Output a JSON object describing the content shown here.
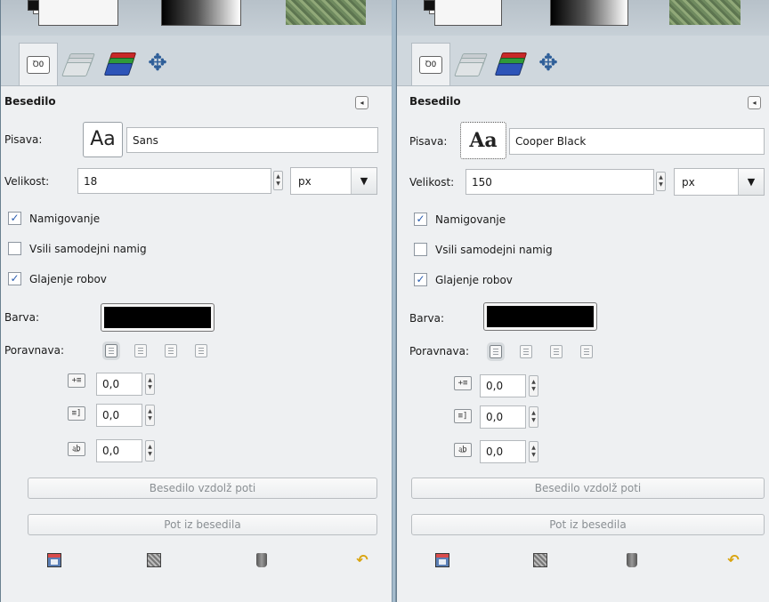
{
  "left": {
    "section_title": "Besedilo",
    "font_label": "Pisava:",
    "font_preview": "Aa",
    "font_name": "Sans",
    "size_label": "Velikost:",
    "size_value": "18",
    "unit": "px",
    "checkboxes": [
      {
        "label": "Namigovanje",
        "checked": true
      },
      {
        "label": "Vsili samodejni namig",
        "checked": false
      },
      {
        "label": "Glajenje robov",
        "checked": true
      }
    ],
    "color_label": "Barva:",
    "color_value": "#000000",
    "justify_label": "Poravnava:",
    "indent_value": "0,0",
    "line_spacing_value": "0,0",
    "letter_spacing_value": "0,0",
    "path_button": "Besedilo vzdolž poti",
    "path_from_text_button": "Pot iz besedila"
  },
  "right": {
    "section_title": "Besedilo",
    "font_label": "Pisava:",
    "font_preview": "Aa",
    "font_name": "Cooper Black",
    "size_label": "Velikost:",
    "size_value": "150",
    "unit": "px",
    "checkboxes": [
      {
        "label": "Namigovanje",
        "checked": true
      },
      {
        "label": "Vsili samodejni namig",
        "checked": false
      },
      {
        "label": "Glajenje robov",
        "checked": true
      }
    ],
    "color_label": "Barva:",
    "color_value": "#000000",
    "justify_label": "Poravnava:",
    "indent_value": "0,0",
    "line_spacing_value": "0,0",
    "letter_spacing_value": "0,0",
    "path_button": "Besedilo vzdolž poti",
    "path_from_text_button": "Pot iz besedila"
  },
  "icons": {
    "tabs": [
      "tool-options-icon",
      "layers-icon",
      "channels-icon",
      "move-icon"
    ],
    "bottom": [
      "save-preset-icon",
      "restore-preset-icon",
      "delete-preset-icon",
      "reset-defaults-icon"
    ],
    "checkmark": "✓"
  }
}
